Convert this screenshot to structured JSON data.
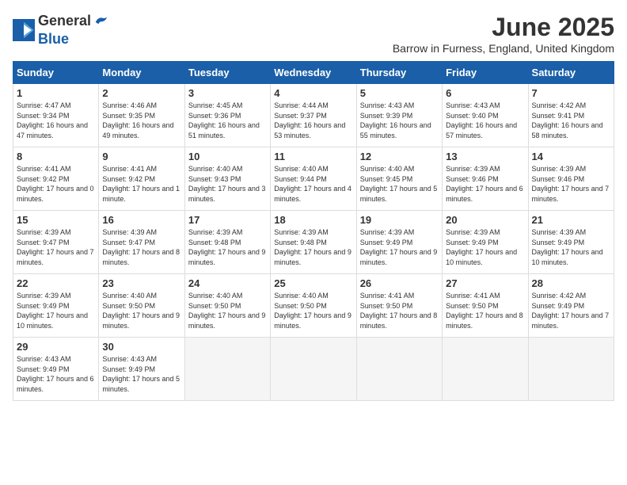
{
  "logo": {
    "general": "General",
    "blue": "Blue"
  },
  "header": {
    "month_year": "June 2025",
    "location": "Barrow in Furness, England, United Kingdom"
  },
  "weekdays": [
    "Sunday",
    "Monday",
    "Tuesday",
    "Wednesday",
    "Thursday",
    "Friday",
    "Saturday"
  ],
  "weeks": [
    [
      {
        "day": "1",
        "sunrise": "4:47 AM",
        "sunset": "9:34 PM",
        "daylight": "16 hours and 47 minutes."
      },
      {
        "day": "2",
        "sunrise": "4:46 AM",
        "sunset": "9:35 PM",
        "daylight": "16 hours and 49 minutes."
      },
      {
        "day": "3",
        "sunrise": "4:45 AM",
        "sunset": "9:36 PM",
        "daylight": "16 hours and 51 minutes."
      },
      {
        "day": "4",
        "sunrise": "4:44 AM",
        "sunset": "9:37 PM",
        "daylight": "16 hours and 53 minutes."
      },
      {
        "day": "5",
        "sunrise": "4:43 AM",
        "sunset": "9:39 PM",
        "daylight": "16 hours and 55 minutes."
      },
      {
        "day": "6",
        "sunrise": "4:43 AM",
        "sunset": "9:40 PM",
        "daylight": "16 hours and 57 minutes."
      },
      {
        "day": "7",
        "sunrise": "4:42 AM",
        "sunset": "9:41 PM",
        "daylight": "16 hours and 58 minutes."
      }
    ],
    [
      {
        "day": "8",
        "sunrise": "4:41 AM",
        "sunset": "9:42 PM",
        "daylight": "17 hours and 0 minutes."
      },
      {
        "day": "9",
        "sunrise": "4:41 AM",
        "sunset": "9:42 PM",
        "daylight": "17 hours and 1 minute."
      },
      {
        "day": "10",
        "sunrise": "4:40 AM",
        "sunset": "9:43 PM",
        "daylight": "17 hours and 3 minutes."
      },
      {
        "day": "11",
        "sunrise": "4:40 AM",
        "sunset": "9:44 PM",
        "daylight": "17 hours and 4 minutes."
      },
      {
        "day": "12",
        "sunrise": "4:40 AM",
        "sunset": "9:45 PM",
        "daylight": "17 hours and 5 minutes."
      },
      {
        "day": "13",
        "sunrise": "4:39 AM",
        "sunset": "9:46 PM",
        "daylight": "17 hours and 6 minutes."
      },
      {
        "day": "14",
        "sunrise": "4:39 AM",
        "sunset": "9:46 PM",
        "daylight": "17 hours and 7 minutes."
      }
    ],
    [
      {
        "day": "15",
        "sunrise": "4:39 AM",
        "sunset": "9:47 PM",
        "daylight": "17 hours and 7 minutes."
      },
      {
        "day": "16",
        "sunrise": "4:39 AM",
        "sunset": "9:47 PM",
        "daylight": "17 hours and 8 minutes."
      },
      {
        "day": "17",
        "sunrise": "4:39 AM",
        "sunset": "9:48 PM",
        "daylight": "17 hours and 9 minutes."
      },
      {
        "day": "18",
        "sunrise": "4:39 AM",
        "sunset": "9:48 PM",
        "daylight": "17 hours and 9 minutes."
      },
      {
        "day": "19",
        "sunrise": "4:39 AM",
        "sunset": "9:49 PM",
        "daylight": "17 hours and 9 minutes."
      },
      {
        "day": "20",
        "sunrise": "4:39 AM",
        "sunset": "9:49 PM",
        "daylight": "17 hours and 10 minutes."
      },
      {
        "day": "21",
        "sunrise": "4:39 AM",
        "sunset": "9:49 PM",
        "daylight": "17 hours and 10 minutes."
      }
    ],
    [
      {
        "day": "22",
        "sunrise": "4:39 AM",
        "sunset": "9:49 PM",
        "daylight": "17 hours and 10 minutes."
      },
      {
        "day": "23",
        "sunrise": "4:40 AM",
        "sunset": "9:50 PM",
        "daylight": "17 hours and 9 minutes."
      },
      {
        "day": "24",
        "sunrise": "4:40 AM",
        "sunset": "9:50 PM",
        "daylight": "17 hours and 9 minutes."
      },
      {
        "day": "25",
        "sunrise": "4:40 AM",
        "sunset": "9:50 PM",
        "daylight": "17 hours and 9 minutes."
      },
      {
        "day": "26",
        "sunrise": "4:41 AM",
        "sunset": "9:50 PM",
        "daylight": "17 hours and 8 minutes."
      },
      {
        "day": "27",
        "sunrise": "4:41 AM",
        "sunset": "9:50 PM",
        "daylight": "17 hours and 8 minutes."
      },
      {
        "day": "28",
        "sunrise": "4:42 AM",
        "sunset": "9:49 PM",
        "daylight": "17 hours and 7 minutes."
      }
    ],
    [
      {
        "day": "29",
        "sunrise": "4:43 AM",
        "sunset": "9:49 PM",
        "daylight": "17 hours and 6 minutes."
      },
      {
        "day": "30",
        "sunrise": "4:43 AM",
        "sunset": "9:49 PM",
        "daylight": "17 hours and 5 minutes."
      },
      null,
      null,
      null,
      null,
      null
    ]
  ]
}
